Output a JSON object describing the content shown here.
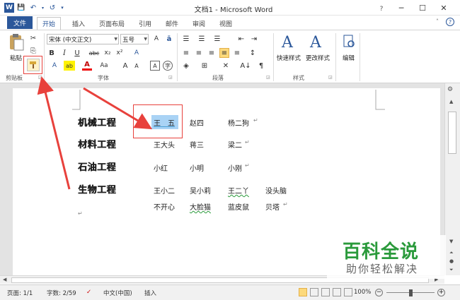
{
  "window": {
    "title": "文档1 - Microsoft Word",
    "minimize": "─",
    "restore": "☐",
    "close": "✕",
    "help": "?"
  },
  "qat": {
    "save": "💾",
    "undo": "↶",
    "redo": "↺"
  },
  "tabs": [
    "文件",
    "开始",
    "插入",
    "页面布局",
    "引用",
    "邮件",
    "审阅",
    "视图"
  ],
  "ribbon": {
    "clipboard": {
      "paste": "粘贴",
      "label": "剪贴板"
    },
    "font": {
      "name": "宋体 (中文正文)",
      "size": "五号",
      "label": "字体",
      "bold": "B",
      "italic": "I",
      "underline": "U",
      "strike": "abc",
      "sub": "x₂",
      "sup": "x²",
      "grow": "A",
      "shrink": "A",
      "aa": "Aa",
      "font_color": "A",
      "highlight": "ab"
    },
    "paragraph": {
      "label": "段落"
    },
    "styles": {
      "quick": "快速样式",
      "change": "更改样式",
      "label": "样式"
    },
    "editing": {
      "label": "编辑"
    }
  },
  "document": {
    "rows": [
      {
        "head": "机械工程",
        "names": [
          "王　五",
          "赵四",
          "杨二狗"
        ]
      },
      {
        "head": "材料工程",
        "names": [
          "王大头",
          "蒋三",
          "梁二"
        ]
      },
      {
        "head": "石油工程",
        "names": [
          "小红",
          "小明",
          "小刚"
        ]
      },
      {
        "head": "生物工程",
        "names": [
          "王小二",
          "吴小莉",
          "王二丫",
          "没头脑"
        ]
      },
      {
        "head": "",
        "names": [
          "不开心",
          "大脸猫",
          "蓝皮鼠",
          "贝塔"
        ]
      }
    ],
    "para_mark": "↵"
  },
  "status": {
    "page": "页面: 1/1",
    "words": "字数: 2/59",
    "lang": "中文(中国)",
    "insert": "插入",
    "zoom": "100%",
    "zoom_fraction": 0.5
  },
  "watermark": {
    "main": "百科全说",
    "sub": "助你轻松解决"
  },
  "colors": {
    "accent": "#2b579a",
    "annotation": "#e8413c",
    "selection": "#a9d3f5",
    "watermark": "#2a9a3b"
  }
}
